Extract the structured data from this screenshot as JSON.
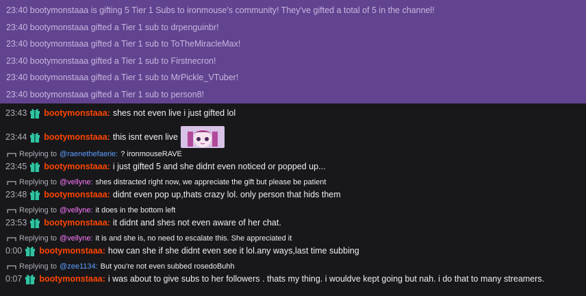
{
  "sub_notifications": [
    {
      "time": "23:40",
      "text": "bootymonstaaa is gifting 5 Tier 1 Subs to ironmouse's community! They've gifted a total of 5 in the channel!"
    },
    {
      "time": "23:40",
      "text": "bootymonstaaa gifted a Tier 1 sub to drpenguinbr!"
    },
    {
      "time": "23:40",
      "text": "bootymonstaaa gifted a Tier 1 sub to ToTheMiracleMax!"
    },
    {
      "time": "23:40",
      "text": "bootymonstaaa gifted a Tier 1 sub to Firstnecron!"
    },
    {
      "time": "23:40",
      "text": "bootymonstaaa gifted a Tier 1 sub to MrPickle_VTuber!"
    },
    {
      "time": "23:40",
      "text": "bootymonstaaa gifted a Tier 1 sub to person8!"
    }
  ],
  "messages": [
    {
      "time": "23:43",
      "user": "bootymonstaaa:",
      "text": "shes not even live i just gifted lol"
    },
    {
      "time": "23:44",
      "user": "bootymonstaaa:",
      "text": "this isnt even live",
      "emote": "ironmouseRAVE-emote"
    },
    {
      "reply_prefix": "Replying to",
      "reply_to": "@raenethefaerie:",
      "reply_text": "? ironmouseRAVE",
      "time": "23:45",
      "user": "bootymonstaaa:",
      "text": "i just gifted 5 and she didnt even noticed or popped up..."
    },
    {
      "reply_prefix": "Replying to",
      "reply_to": "@vellyne:",
      "reply_text": "shes distracted right now, we appreciate the gift but please be patient",
      "time": "23:48",
      "user": "bootymonstaaa:",
      "text": "didnt even pop up,thats crazy lol. only person that hids them"
    },
    {
      "reply_prefix": "Replying to",
      "reply_to": "@vellyne:",
      "reply_text": "it does in the bottom left",
      "time": "23:53",
      "user": "bootymonstaaa:",
      "text": "it didnt and shes not even aware of her chat."
    },
    {
      "reply_prefix": "Replying to",
      "reply_to": "@vellyne:",
      "reply_text": "it is and she is, no need to escalate this. She appreciated it",
      "time": "0:00",
      "user": "bootymonstaaa:",
      "text": "how can she if she didnt even see it lol.any ways,last time subbing"
    },
    {
      "reply_prefix": "Replying to",
      "reply_to": "@zee1134:",
      "reply_text": "But you're not even subbed rosedoBuhh",
      "time": "0:07",
      "user": "bootymonstaaa:",
      "text": "i was about to give subs to her followers . thats my thing. i wouldve kept going but nah. i do that to many streamers."
    }
  ],
  "icons": {
    "badge": "gift-badge-icon",
    "reply": "reply-arrow-icon"
  },
  "colors": {
    "sub_bg": "#624390",
    "chat_bg": "#18181b",
    "username": "#ff4500",
    "mention_blue": "#5e9eff",
    "mention_pink": "#ff7bff"
  }
}
